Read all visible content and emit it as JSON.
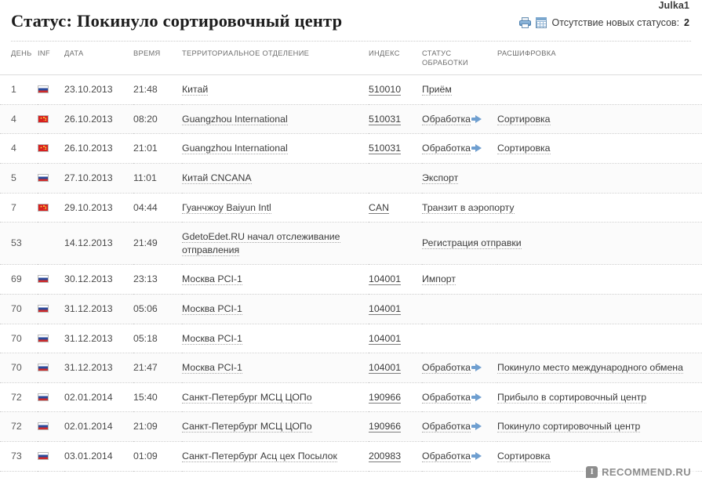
{
  "header": {
    "username": "Julka1",
    "title": "Статус: Покинуло сортировочный центр",
    "printer_icon": "printer-icon",
    "calendar_icon": "calendar-icon",
    "status_note_text": "Отсутствие новых статусов:",
    "status_note_count": "2"
  },
  "table": {
    "columns": [
      "День",
      "Inf",
      "Дата",
      "Время",
      "Территориальное отделение",
      "Индекс",
      "Статус обработки",
      "Расшифровка"
    ],
    "rows": [
      {
        "day": "1",
        "flag": "ru",
        "date": "23.10.2013",
        "time": "21:48",
        "office": "Китай",
        "index": "510010",
        "status": "Приём",
        "arrow": false,
        "desc": ""
      },
      {
        "day": "4",
        "flag": "cn",
        "date": "26.10.2013",
        "time": "08:20",
        "office": "Guangzhou International",
        "index": "510031",
        "status": "Обработка",
        "arrow": true,
        "desc": "Сортировка"
      },
      {
        "day": "4",
        "flag": "cn",
        "date": "26.10.2013",
        "time": "21:01",
        "office": "Guangzhou International",
        "index": "510031",
        "status": "Обработка",
        "arrow": true,
        "desc": "Сортировка"
      },
      {
        "day": "5",
        "flag": "ru",
        "date": "27.10.2013",
        "time": "11:01",
        "office": "Китай CNCANA",
        "index": "",
        "status": "Экспорт",
        "arrow": false,
        "desc": ""
      },
      {
        "day": "7",
        "flag": "cn",
        "date": "29.10.2013",
        "time": "04:44",
        "office": "Гуанчжоу Baiyun Intl",
        "index": "CAN",
        "status": "Транзит в аэропорту",
        "arrow": false,
        "desc": ""
      },
      {
        "day": "53",
        "flag": "",
        "date": "14.12.2013",
        "time": "21:49",
        "office": "GdetoEdet.RU начал отслеживание отправления",
        "index": "",
        "status": "Регистрация отправки",
        "arrow": false,
        "desc": ""
      },
      {
        "day": "69",
        "flag": "ru",
        "date": "30.12.2013",
        "time": "23:13",
        "office": "Москва PCI-1",
        "index": "104001",
        "status": "Импорт",
        "arrow": false,
        "desc": ""
      },
      {
        "day": "70",
        "flag": "ru",
        "date": "31.12.2013",
        "time": "05:06",
        "office": "Москва PCI-1",
        "index": "104001",
        "status": "",
        "arrow": false,
        "desc": ""
      },
      {
        "day": "70",
        "flag": "ru",
        "date": "31.12.2013",
        "time": "05:18",
        "office": "Москва PCI-1",
        "index": "104001",
        "status": "",
        "arrow": false,
        "desc": ""
      },
      {
        "day": "70",
        "flag": "ru",
        "date": "31.12.2013",
        "time": "21:47",
        "office": "Москва PCI-1",
        "index": "104001",
        "status": "Обработка",
        "arrow": true,
        "desc": "Покинуло место международного обмена"
      },
      {
        "day": "72",
        "flag": "ru",
        "date": "02.01.2014",
        "time": "15:40",
        "office": "Санкт-Петербург МСЦ ЦОПо",
        "index": "190966",
        "status": "Обработка",
        "arrow": true,
        "desc": "Прибыло в сортировочный центр"
      },
      {
        "day": "72",
        "flag": "ru",
        "date": "02.01.2014",
        "time": "21:09",
        "office": "Санкт-Петербург МСЦ ЦОПо",
        "index": "190966",
        "status": "Обработка",
        "arrow": true,
        "desc": "Покинуло сортировочный центр"
      },
      {
        "day": "73",
        "flag": "ru",
        "date": "03.01.2014",
        "time": "01:09",
        "office": "Санкт-Петербург Асц цех Посылок",
        "index": "200983",
        "status": "Обработка",
        "arrow": true,
        "desc": "Сортировка"
      }
    ]
  },
  "watermark": {
    "badge": "I",
    "text": "RECOMMEND.RU"
  }
}
